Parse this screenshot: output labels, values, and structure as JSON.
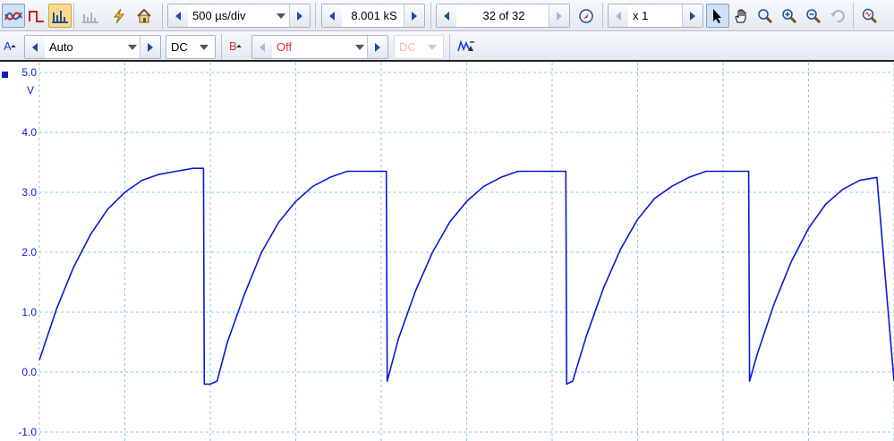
{
  "toolbar": {
    "timebase": "500 µs/div",
    "samples": "8.001 kS",
    "waveform_index": "32 of 32",
    "zoom_factor": "x 1"
  },
  "channel_a": {
    "name": "A",
    "range": "Auto",
    "coupling": "DC",
    "color": "#0a18d8"
  },
  "channel_b": {
    "name": "B",
    "range": "Off",
    "coupling": "DC",
    "color": "#e03030"
  },
  "scope": {
    "y_unit": "V",
    "y_ticks": [
      "5.0",
      "4.0",
      "3.0",
      "2.0",
      "1.0",
      "0.0",
      "-1.0"
    ],
    "grid_color": "#8ec7e6"
  },
  "chart_data": {
    "type": "line",
    "title": "",
    "xlabel": "",
    "ylabel": "V",
    "x_unit": "µs",
    "xlim": [
      0,
      5000
    ],
    "ylim": [
      -1.0,
      5.0
    ],
    "grid": true,
    "series": [
      {
        "color": "#0a18d8",
        "x": [
          0,
          100,
          200,
          300,
          400,
          500,
          600,
          700,
          800,
          900,
          960,
          965,
          1000,
          1040,
          1100,
          1200,
          1300,
          1400,
          1500,
          1600,
          1700,
          1800,
          1900,
          2000,
          2030,
          2035,
          2100,
          2200,
          2300,
          2400,
          2500,
          2600,
          2700,
          2800,
          2900,
          3000,
          3080,
          3085,
          3120,
          3200,
          3300,
          3400,
          3500,
          3600,
          3700,
          3800,
          3900,
          4000,
          4100,
          4150,
          4155,
          4200,
          4300,
          4400,
          4500,
          4600,
          4700,
          4800,
          4900,
          5000
        ],
        "y": [
          0.2,
          1.05,
          1.75,
          2.3,
          2.72,
          3.0,
          3.2,
          3.3,
          3.35,
          3.4,
          3.4,
          -0.2,
          -0.2,
          -0.15,
          0.5,
          1.3,
          2.0,
          2.5,
          2.85,
          3.1,
          3.25,
          3.35,
          3.35,
          3.35,
          3.35,
          -0.15,
          0.55,
          1.35,
          2.0,
          2.5,
          2.85,
          3.1,
          3.25,
          3.35,
          3.35,
          3.35,
          3.35,
          -0.2,
          -0.15,
          0.6,
          1.4,
          2.05,
          2.55,
          2.9,
          3.1,
          3.25,
          3.35,
          3.35,
          3.35,
          3.35,
          -0.15,
          0.3,
          1.15,
          1.85,
          2.4,
          2.8,
          3.05,
          3.2,
          3.25,
          -0.15
        ]
      }
    ]
  }
}
